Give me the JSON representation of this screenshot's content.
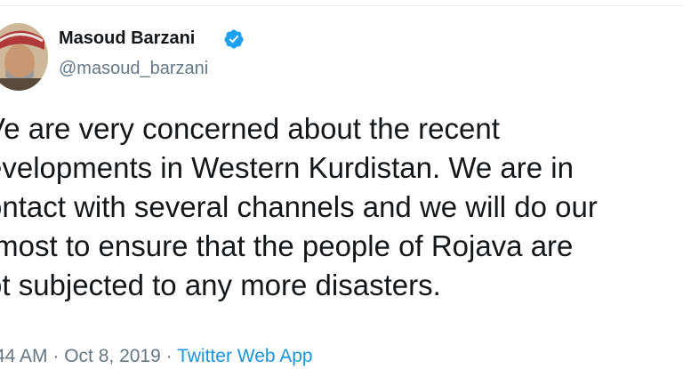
{
  "tweet": {
    "author": {
      "display_name": "Masoud Barzani",
      "handle": "@masoud_barzani",
      "verified": true,
      "avatar_icon": "profile-photo-icon",
      "verified_icon": "verified-badge-icon"
    },
    "text_lines": [
      "Ve are very concerned about the recent",
      "evelopments in Western Kurdistan. We are in",
      "ontact with several channels and we will do our",
      "tmost to ensure that the people of Rojava are",
      "ot subjected to any more disasters."
    ],
    "meta": {
      "time": "44 AM",
      "separator": " · ",
      "date": "Oct 8, 2019",
      "source": "Twitter Web App"
    }
  },
  "colors": {
    "text": "#14171a",
    "secondary": "#657786",
    "accent": "#1b95e0",
    "verified": "#1da1f2"
  }
}
